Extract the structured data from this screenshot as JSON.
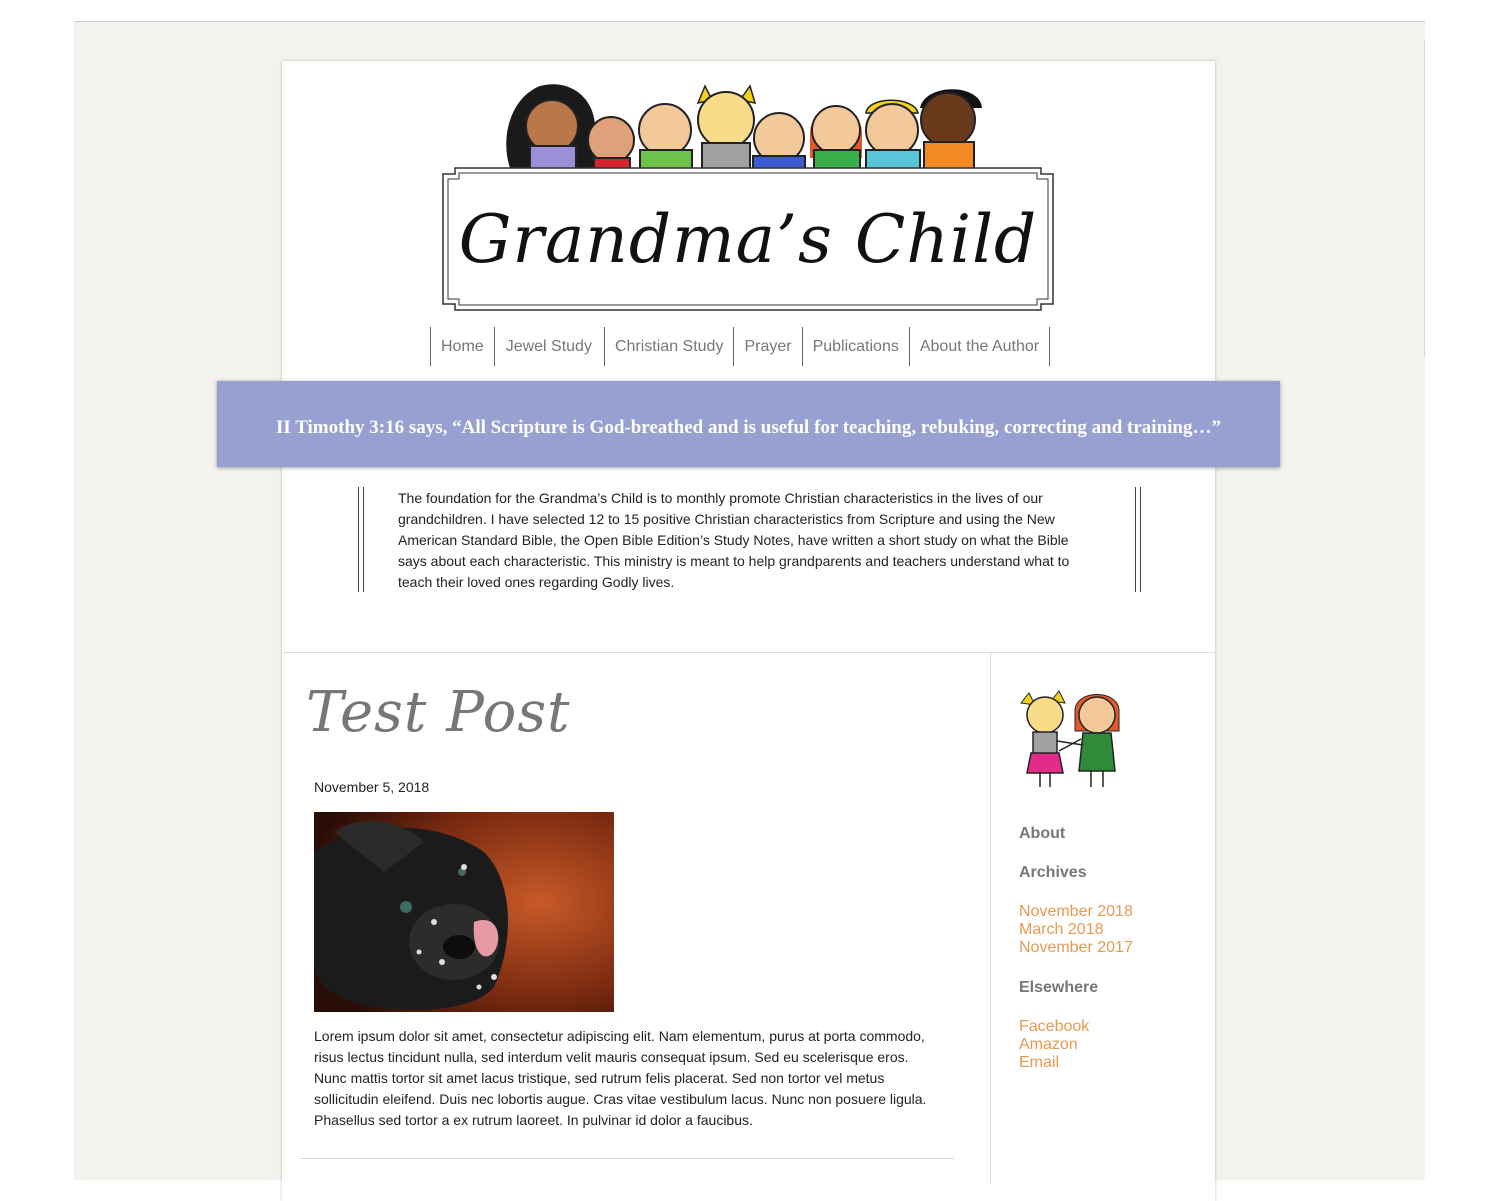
{
  "site": {
    "title": "Grandma’s Child"
  },
  "nav": {
    "items": [
      {
        "label": "Home"
      },
      {
        "label": "Jewel Study"
      },
      {
        "label": "Christian Study"
      },
      {
        "label": "Prayer"
      },
      {
        "label": "Publications"
      },
      {
        "label": "About the Author"
      }
    ]
  },
  "banner": {
    "text": "II Timothy 3:16 says, “All Scripture is God-breathed and is useful for teaching, rebuking, correcting and training…”"
  },
  "intro": {
    "text": "The foundation for the Grandma’s Child is to monthly promote Christian characteristics in the lives of our grandchildren. I have selected 12 to 15 positive Christian characteristics from Scripture and using the New American Standard Bible, the Open Bible Edition’s Study Notes, have written a short study on what the Bible says about each characteristic. This ministry is meant to help grandparents and teachers understand what to teach their loved ones regarding Godly lives."
  },
  "post": {
    "title": "Test Post",
    "date": "November 5, 2018",
    "body": "Lorem ipsum dolor sit amet, consectetur adipiscing elit. Nam elementum, purus at porta commodo, risus lectus tincidunt nulla, sed interdum velit mauris consequat ipsum. Sed eu scelerisque eros. Nunc mattis tortor sit amet lacus tristique, sed rutrum felis placerat. Sed non tortor vel metus sollicitudin eleifend. Duis nec lobortis augue. Cras vitae vestibulum lacus. Nunc non posuere ligula. Phasellus sed tortor a ex rutrum laoreet. In pulvinar id dolor a faucibus."
  },
  "sidebar": {
    "about_heading": "About",
    "archives_heading": "Archives",
    "archives": [
      {
        "label": "November 2018"
      },
      {
        "label": "March 2018"
      },
      {
        "label": "November 2017"
      }
    ],
    "elsewhere_heading": "Elsewhere",
    "elsewhere": [
      {
        "label": "Facebook"
      },
      {
        "label": "Amazon"
      },
      {
        "label": "Email"
      }
    ]
  },
  "colors": {
    "banner": "#97a0d1",
    "link": "#e69a4f",
    "page_bg": "#f3f2ec"
  }
}
